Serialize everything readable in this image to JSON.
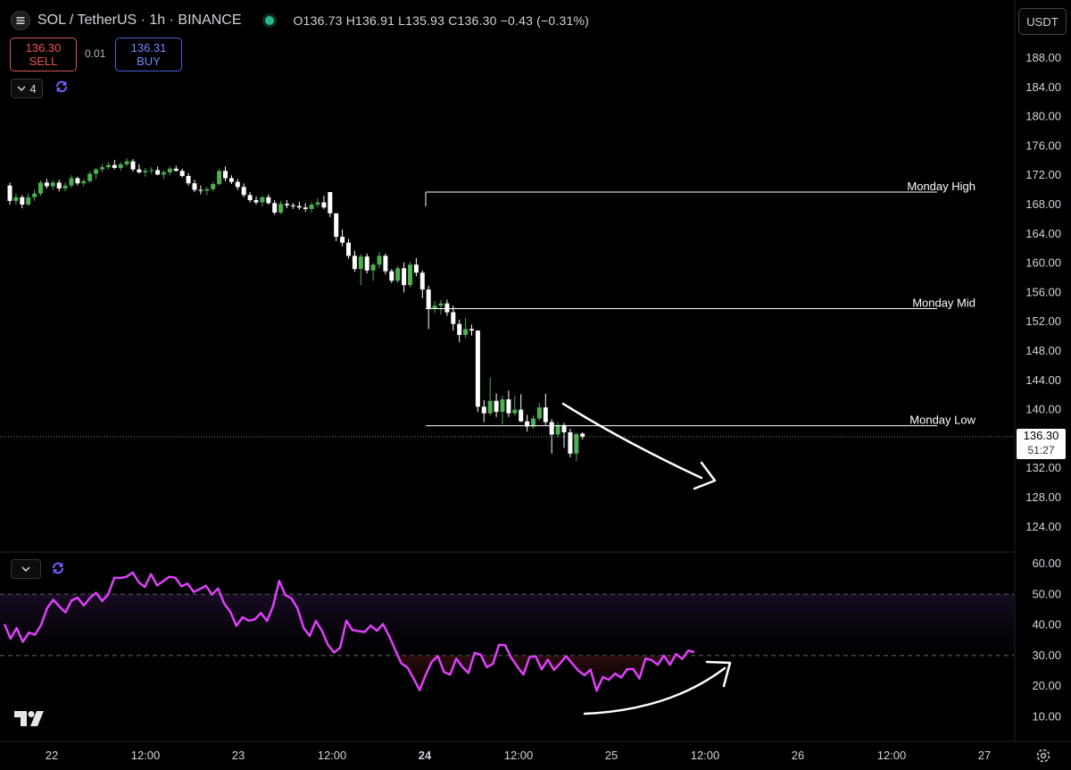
{
  "header": {
    "title": "SOL / TetherUS · 1h · BINANCE",
    "ohlc": "O136.73  H136.91  L135.93  C136.30  −0.43 (−0.31%)"
  },
  "trade": {
    "sell_price": "136.30",
    "sell_label": "SELL",
    "spread": "0.01",
    "buy_price": "136.31",
    "buy_label": "BUY"
  },
  "indicator_count": "4",
  "currency": "USDT",
  "last_price": "136.30",
  "countdown": "51:27",
  "colors": {
    "bull": "#4caf50",
    "bear": "#ffffff",
    "rsi": "#e040fb",
    "background": "#000000"
  },
  "chart_data": [
    {
      "type": "candlestick",
      "title": "SOL / TetherUS · 1h · BINANCE",
      "ylim": [
        120,
        192
      ],
      "y_ticks": [
        124,
        128,
        132,
        136,
        140,
        144,
        148,
        152,
        156,
        160,
        164,
        168,
        172,
        176,
        180,
        184,
        188
      ],
      "x_ticks": [
        "22",
        "12:00",
        "23",
        "12:00",
        "24",
        "12:00",
        "25",
        "12:00",
        "26",
        "12:00",
        "27"
      ],
      "candles": [
        [
          170.6,
          171.0,
          168.0,
          168.5
        ],
        [
          168.5,
          169.5,
          168.0,
          169.0
        ],
        [
          169.0,
          169.3,
          167.5,
          168.0
        ],
        [
          168.0,
          169.5,
          167.8,
          169.0
        ],
        [
          169.0,
          170.0,
          168.5,
          169.5
        ],
        [
          169.5,
          171.3,
          169.2,
          171.0
        ],
        [
          171.0,
          171.5,
          170.2,
          170.5
        ],
        [
          170.5,
          171.3,
          170.0,
          171.0
        ],
        [
          171.0,
          171.4,
          169.8,
          170.2
        ],
        [
          170.2,
          171.0,
          169.8,
          170.6
        ],
        [
          170.6,
          172.0,
          170.3,
          171.6
        ],
        [
          171.6,
          171.8,
          170.6,
          170.9
        ],
        [
          170.9,
          171.5,
          170.5,
          171.2
        ],
        [
          171.2,
          172.5,
          171.0,
          172.2
        ],
        [
          172.2,
          173.0,
          171.5,
          172.8
        ],
        [
          172.8,
          173.5,
          172.4,
          173.1
        ],
        [
          173.1,
          173.8,
          172.8,
          173.4
        ],
        [
          173.4,
          174.1,
          172.8,
          173.0
        ],
        [
          173.0,
          173.8,
          172.6,
          173.5
        ],
        [
          173.5,
          174.3,
          173.2,
          173.9
        ],
        [
          173.9,
          174.2,
          172.5,
          172.8
        ],
        [
          172.8,
          173.5,
          172.2,
          172.4
        ],
        [
          172.4,
          173.0,
          171.8,
          172.6
        ],
        [
          172.6,
          173.1,
          172.2,
          172.7
        ],
        [
          172.7,
          173.2,
          172.0,
          172.1
        ],
        [
          172.1,
          172.7,
          171.5,
          172.4
        ],
        [
          172.4,
          173.2,
          172.0,
          172.9
        ],
        [
          172.9,
          173.3,
          172.5,
          172.6
        ],
        [
          172.6,
          172.9,
          171.7,
          171.9
        ],
        [
          171.9,
          172.3,
          170.6,
          170.9
        ],
        [
          170.9,
          171.4,
          169.7,
          170.0
        ],
        [
          170.0,
          170.6,
          169.4,
          169.9
        ],
        [
          169.9,
          170.4,
          169.3,
          170.1
        ],
        [
          170.1,
          171.1,
          169.8,
          170.8
        ],
        [
          170.8,
          172.9,
          170.6,
          172.6
        ],
        [
          172.6,
          173.2,
          171.2,
          171.6
        ],
        [
          171.6,
          172.0,
          170.8,
          171.1
        ],
        [
          171.1,
          171.5,
          170.0,
          170.4
        ],
        [
          170.4,
          170.9,
          169.0,
          169.3
        ],
        [
          169.3,
          169.7,
          168.3,
          168.6
        ],
        [
          168.6,
          169.1,
          168.0,
          168.3
        ],
        [
          168.3,
          169.2,
          167.7,
          169.0
        ],
        [
          169.0,
          169.4,
          168.0,
          168.2
        ],
        [
          168.2,
          168.6,
          166.6,
          166.9
        ],
        [
          166.9,
          168.5,
          166.7,
          168.1
        ],
        [
          168.1,
          168.6,
          167.5,
          167.9
        ],
        [
          167.9,
          168.2,
          167.4,
          167.8
        ],
        [
          167.8,
          168.4,
          167.3,
          167.6
        ],
        [
          167.6,
          168.2,
          167.0,
          167.4
        ],
        [
          167.4,
          168.3,
          166.9,
          168.0
        ],
        [
          168.0,
          168.9,
          167.6,
          168.3
        ],
        [
          168.3,
          169.2,
          167.4,
          167.6
        ],
        [
          169.7,
          169.7,
          166.3,
          166.8
        ],
        [
          166.8,
          166.8,
          163.0,
          163.6
        ],
        [
          163.6,
          164.6,
          162.3,
          162.8
        ],
        [
          162.8,
          163.3,
          160.6,
          161.0
        ],
        [
          161.0,
          161.7,
          158.8,
          159.2
        ],
        [
          159.2,
          161.2,
          157.0,
          160.9
        ],
        [
          160.9,
          161.3,
          158.6,
          159.0
        ],
        [
          159.0,
          160.0,
          157.6,
          159.8
        ],
        [
          159.8,
          161.5,
          159.3,
          161.0
        ],
        [
          161.0,
          161.3,
          158.5,
          158.9
        ],
        [
          158.9,
          159.2,
          157.3,
          157.6
        ],
        [
          157.6,
          159.6,
          157.3,
          159.3
        ],
        [
          159.3,
          160.1,
          156.0,
          157.0
        ],
        [
          157.0,
          160.2,
          156.7,
          159.8
        ],
        [
          159.8,
          160.7,
          158.2,
          158.7
        ],
        [
          158.7,
          159.0,
          155.2,
          156.4
        ],
        [
          156.4,
          156.9,
          151.0,
          153.8
        ],
        [
          153.8,
          154.8,
          153.2,
          154.2
        ],
        [
          154.2,
          155.0,
          153.0,
          154.5
        ],
        [
          154.5,
          155.0,
          152.8,
          153.3
        ],
        [
          153.3,
          154.2,
          150.8,
          151.7
        ],
        [
          151.7,
          152.3,
          149.2,
          150.2
        ],
        [
          150.2,
          152.5,
          149.8,
          151.0
        ],
        [
          151.0,
          151.6,
          150.1,
          150.8
        ],
        [
          150.8,
          150.8,
          139.7,
          140.4
        ],
        [
          140.4,
          141.3,
          138.3,
          139.5
        ],
        [
          139.5,
          144.4,
          139.2,
          141.2
        ],
        [
          141.2,
          142.2,
          139.0,
          139.7
        ],
        [
          139.7,
          141.9,
          138.0,
          141.4
        ],
        [
          141.4,
          142.6,
          139.0,
          139.5
        ],
        [
          139.5,
          141.9,
          139.2,
          140.0
        ],
        [
          140.0,
          142.1,
          138.3,
          138.4
        ],
        [
          138.4,
          139.3,
          137.0,
          137.7
        ],
        [
          137.7,
          139.2,
          137.4,
          138.8
        ],
        [
          138.8,
          140.9,
          138.5,
          140.3
        ],
        [
          140.3,
          142.2,
          137.9,
          138.3
        ],
        [
          138.3,
          138.7,
          134.0,
          136.6
        ],
        [
          136.6,
          138.3,
          136.2,
          137.9
        ],
        [
          137.9,
          138.2,
          134.8,
          136.9
        ],
        [
          136.9,
          137.4,
          133.5,
          134.0
        ],
        [
          134.0,
          136.5,
          133.0,
          136.7
        ],
        [
          136.73,
          136.91,
          135.93,
          136.3
        ]
      ]
    },
    {
      "type": "line",
      "series": [
        {
          "values": [
            40.3,
            35.5,
            39.0,
            34.5,
            37.5,
            36.8,
            40.0,
            45.5,
            48.2,
            46.0,
            44.1,
            48.0,
            48.9,
            46.3,
            48.8,
            50.5,
            47.8,
            50.0,
            55.4,
            55.3,
            55.7,
            57.1,
            53.9,
            52.4,
            56.6,
            52.9,
            54.3,
            55.7,
            55.4,
            52.6,
            53.5,
            50.8,
            51.7,
            52.8,
            49.9,
            51.9,
            46.9,
            44.3,
            39.7,
            42.5,
            41.4,
            41.8,
            43.9,
            41.3,
            46.2,
            54.4,
            49.8,
            48.7,
            45.4,
            39.1,
            36.4,
            41.3,
            38.1,
            33.4,
            31.0,
            32.6,
            41.4,
            38.3,
            38.0,
            37.7,
            39.8,
            38.1,
            40.3,
            36.4,
            31.9,
            27.5,
            26.1,
            22.6,
            18.7,
            23.7,
            28.0,
            29.8,
            24.6,
            23.8,
            29.0,
            26.3,
            24.3,
            30.9,
            30.3,
            26.2,
            27.3,
            33.5,
            33.4,
            29.3,
            26.4,
            23.8,
            29.5,
            29.8,
            25.5,
            28.7,
            25.3,
            27.4,
            29.8,
            27.4,
            25.1,
            23.6,
            25.4,
            18.5,
            23.0,
            22.1,
            24.1,
            22.8,
            25.5,
            25.6,
            22.5,
            29.0,
            28.5,
            27.0,
            30.0,
            27.0,
            30.5,
            28.9,
            31.6,
            31.1
          ]
        }
      ],
      "ylim": [
        5,
        62
      ],
      "y_ticks": [
        10,
        20,
        30,
        40,
        50,
        60
      ],
      "levels": [
        30,
        50
      ]
    }
  ],
  "annotations": {
    "monday_high": 169.7,
    "monday_mid": 153.8,
    "monday_low": 137.8
  },
  "labels": {
    "monday_high": "Monday High",
    "monday_mid": "Monday Mid",
    "monday_low": "Monday Low"
  }
}
